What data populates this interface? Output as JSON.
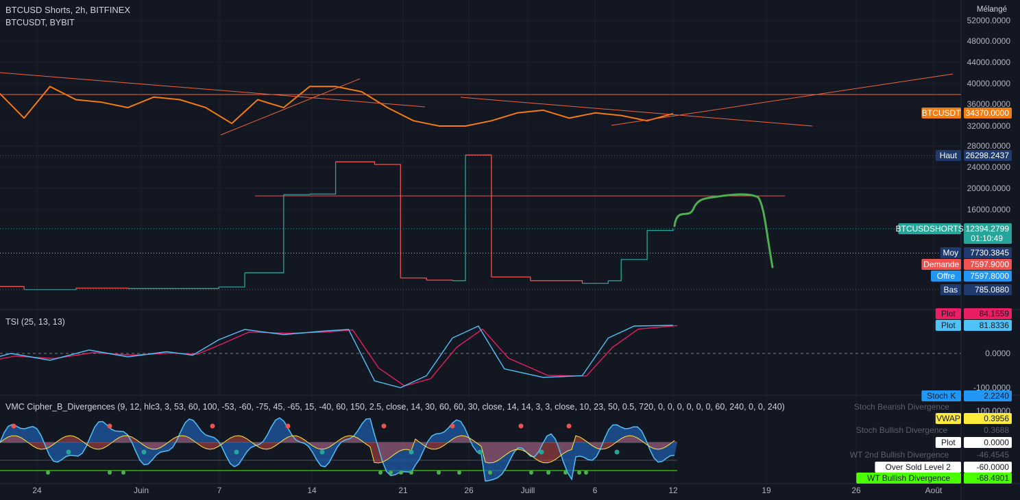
{
  "header": {
    "symbol": "BTCUSD Shorts, 2h, BITFINEX",
    "compare": "BTCUSDT, BYBIT",
    "scale_mode": "Mélangé"
  },
  "colors": {
    "background": "#131722",
    "btcusdt": "#f57c0f",
    "up": "#26a69a",
    "down": "#ef5350",
    "trend_line": "#f0643c",
    "drawing": "#4caf50",
    "tsi": "#4fc3f7",
    "tsi_signal": "#e91e63"
  },
  "x_axis": {
    "labels": [
      "24",
      "Juin",
      "7",
      "14",
      "21",
      "26",
      "Juill",
      "6",
      "12",
      "19",
      "26",
      "Août"
    ]
  },
  "main_axis": {
    "ticks": [
      "52000.0000",
      "48000.0000",
      "44000.0000",
      "40000.0000",
      "36000.0000",
      "32000.0000",
      "28000.0000",
      "24000.0000",
      "20000.0000",
      "16000.0000"
    ]
  },
  "price_tags": [
    {
      "label": "BTCUSDT",
      "value": "34370.0000",
      "color": "#f57c0f"
    },
    {
      "label": "Haut",
      "value": "26298.2437",
      "color": "#1e3a6e"
    },
    {
      "label": "BTCUSDSHORTS",
      "value": "12394.2799",
      "extra": "01:10:49",
      "color": "#26a69a"
    },
    {
      "label": "Moy",
      "value": "7730.3845",
      "color": "#1e3a6e"
    },
    {
      "label": "Demande",
      "value": "7597.9000",
      "color": "#ef5350"
    },
    {
      "label": "Offre",
      "value": "7597.8000",
      "color": "#2196f3"
    },
    {
      "label": "Bas",
      "value": "785.0880",
      "color": "#1e3a6e"
    }
  ],
  "tsi": {
    "legend": "TSI (25, 13, 13)",
    "ticks": [
      "0.0000",
      "-100.0000"
    ],
    "tags": [
      {
        "label": "Plot",
        "value": "84.1559",
        "color": "#e91e63"
      },
      {
        "label": "Plot",
        "value": "81.8336",
        "color": "#4fc3f7"
      }
    ]
  },
  "vmc": {
    "legend": "VMC Cipher_B_Divergences (9, 12, hlc3, 3, 53, 60, 100, -53, -60, -75, 45, -65, 15, -40, 60, 150, 2.5, close, 14, 30, 60, 60, 30, close, 14, 14, 3, 3, close, 10, 23, 50, 0.5, 720, 0, 0, 0, 0, 0, 0, 60, 240, 0, 0, 240)",
    "ticks": [
      "100.0000"
    ],
    "tags": [
      {
        "label": "Stoch K",
        "value": "2.2240",
        "color": "#2196f3",
        "text_color": "#131722"
      },
      {
        "label": "Stoch Bearish Divergence",
        "value": "",
        "color": "",
        "text_color": "#5d606b"
      },
      {
        "label": "VWAP",
        "value": "0.3956",
        "color": "#ffeb3b",
        "text_color": "#131722"
      },
      {
        "label": "Stoch Bullish Divergence",
        "value": "0.3688",
        "color": "",
        "text_color": "#5d606b"
      },
      {
        "label": "Plot",
        "value": "0.0000",
        "color": "#ffffff",
        "text_color": "#131722"
      },
      {
        "label": "WT 2nd Bullish Divergence",
        "value": "-46.4545",
        "color": "",
        "text_color": "#5d606b"
      },
      {
        "label": "Over Sold Level 2",
        "value": "-60.0000",
        "color": "#ffffff",
        "text_color": "#131722"
      },
      {
        "label": "WT Bullish Divergence",
        "value": "-68.4901",
        "color": "#4cff00",
        "text_color": "#131722"
      }
    ]
  },
  "chart_data": [
    {
      "type": "line",
      "series": [
        {
          "name": "BTCUSDT",
          "x": [
            "May 19",
            "May 21",
            "May 23",
            "May 25",
            "May 27",
            "May 29",
            "May 31",
            "Jun 2",
            "Jun 4",
            "Jun 6",
            "Jun 8",
            "Jun 10",
            "Jun 12",
            "Jun 14",
            "Jun 16",
            "Jun 18",
            "Jun 20",
            "Jun 22",
            "Jun 24",
            "Jun 26",
            "Jun 28",
            "Jun 30",
            "Jul 2",
            "Jul 4",
            "Jul 6",
            "Jul 8",
            "Jul 10",
            "Jul 12"
          ],
          "y": [
            40000,
            38500,
            33500,
            39500,
            37000,
            36500,
            35500,
            37500,
            37000,
            35500,
            32500,
            37000,
            35500,
            39500,
            39500,
            38500,
            35500,
            33000,
            32000,
            32000,
            33000,
            34500,
            35000,
            33500,
            34500,
            34000,
            33000,
            34370
          ]
        }
      ],
      "annotations": [
        "descending trend lines",
        "ascending trend lines",
        "horizontal level 37800"
      ]
    },
    {
      "type": "line",
      "series": [
        {
          "name": "BTCUSDSHORTS",
          "x": [
            "May 19",
            "May 23",
            "May 27",
            "May 31",
            "Jun 4",
            "Jun 7",
            "Jun 9",
            "Jun 12",
            "Jun 14",
            "Jun 16",
            "Jun 19",
            "Jun 21",
            "Jun 23",
            "Jun 25",
            "Jun 26",
            "Jun 28",
            "Jul 1",
            "Jul 5",
            "Jul 7",
            "Jul 8",
            "Jul 10",
            "Jul 12"
          ],
          "y": [
            1400,
            800,
            1100,
            1000,
            1000,
            1300,
            4000,
            18800,
            18900,
            25000,
            24500,
            3000,
            2600,
            2500,
            26298,
            3200,
            2500,
            2000,
            2500,
            6500,
            12000,
            12394
          ]
        }
      ],
      "levels": {
        "high": 26298.2437,
        "average": 7730.3845,
        "low": 785.088
      }
    },
    {
      "type": "line",
      "series": [
        {
          "name": "Plot",
          "x": [
            "May 19",
            "May 22",
            "May 25",
            "May 28",
            "May 31",
            "Jun 3",
            "Jun 5",
            "Jun 7",
            "Jun 9",
            "Jun 12",
            "Jun 15",
            "Jun 17",
            "Jun 19",
            "Jun 21",
            "Jun 23",
            "Jun 25",
            "Jun 27",
            "Jun 29",
            "Jul 2",
            "Jul 5",
            "Jul 7",
            "Jul 9",
            "Jul 12"
          ],
          "y": [
            -30,
            0,
            -20,
            10,
            -10,
            5,
            -5,
            40,
            70,
            55,
            65,
            70,
            -80,
            -100,
            -65,
            45,
            80,
            -45,
            -70,
            -65,
            45,
            80,
            82
          ]
        }
      ],
      "ylim": [
        -100,
        100
      ]
    }
  ]
}
